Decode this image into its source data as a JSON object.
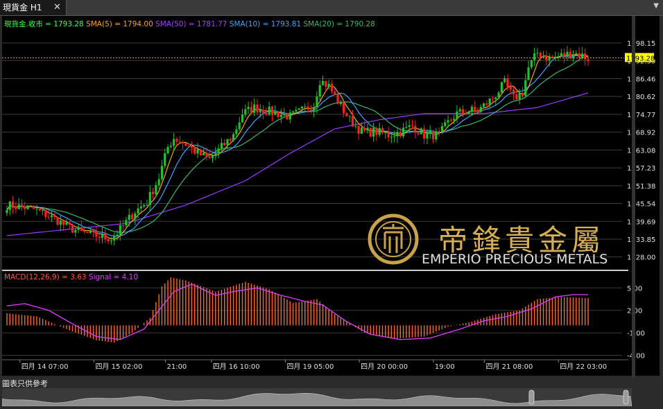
{
  "tab": {
    "title": "現貨金 H1",
    "close": "✕"
  },
  "footer_note": "圖表只供參考",
  "colors": {
    "bull": "#23c12e",
    "bear": "#ff2020",
    "sma5": "#f5a623",
    "sma10": "#3fa3ff",
    "sma20": "#3cb86b",
    "sma50": "#9a3cff",
    "macd_hist": "#ff6a30",
    "signal": "#e040ff",
    "price_line": "#ff9900"
  },
  "brand": {
    "chinese": "帝鋒貴金屬",
    "english": "EMPERIO PRECIOUS METALS"
  },
  "chart_data": [
    {
      "type": "candlestick",
      "title": "現貨金.收市",
      "legend": [
        {
          "label": "現貨金.收市 = 1793.28",
          "color": "#3cff4c"
        },
        {
          "label": "SMA(5) = 1794.00",
          "color": "#f5a623"
        },
        {
          "label": "SMA(50) = 1781.77",
          "color": "#a040ff"
        },
        {
          "label": "SMA(10) = 1793.81",
          "color": "#3fa3ff"
        },
        {
          "label": "SMA(20) = 1790.28",
          "color": "#3cb86b"
        }
      ],
      "ylim": [
        1725.2,
        1801.8
      ],
      "yticks": [
        "1798.15",
        "1792.39",
        "1786.46",
        "1780.62",
        "1774.77",
        "1768.92",
        "1763.08",
        "1757.23",
        "1751.38",
        "1745.54",
        "1739.69",
        "1733.85",
        "1728.00"
      ],
      "last_price": "1793.28",
      "anchors": [
        [
          0,
          1745
        ],
        [
          8,
          1744
        ],
        [
          13,
          1742
        ],
        [
          17,
          1740
        ],
        [
          20,
          1738
        ],
        [
          25,
          1736
        ],
        [
          30,
          1735
        ],
        [
          35,
          1734
        ],
        [
          38,
          1737
        ],
        [
          43,
          1743
        ],
        [
          47,
          1746
        ],
        [
          51,
          1754
        ],
        [
          54,
          1764
        ],
        [
          56,
          1767
        ],
        [
          60,
          1765
        ],
        [
          64,
          1762
        ],
        [
          68,
          1760
        ],
        [
          71,
          1763
        ],
        [
          76,
          1768
        ],
        [
          79,
          1775
        ],
        [
          83,
          1777
        ],
        [
          87,
          1776
        ],
        [
          91,
          1775
        ],
        [
          95,
          1774
        ],
        [
          99,
          1776
        ],
        [
          103,
          1778
        ],
        [
          105,
          1786
        ],
        [
          108,
          1784
        ],
        [
          111,
          1779
        ],
        [
          115,
          1773
        ],
        [
          119,
          1769
        ],
        [
          124,
          1769
        ],
        [
          128,
          1768
        ],
        [
          132,
          1769
        ],
        [
          136,
          1771
        ],
        [
          140,
          1768
        ],
        [
          145,
          1768
        ],
        [
          148,
          1772
        ],
        [
          151,
          1775
        ],
        [
          155,
          1776
        ],
        [
          158,
          1776
        ],
        [
          163,
          1780
        ],
        [
          167,
          1785
        ],
        [
          170,
          1780
        ],
        [
          173,
          1782
        ],
        [
          175,
          1790
        ],
        [
          178,
          1795
        ],
        [
          182,
          1793
        ],
        [
          186,
          1794
        ],
        [
          190,
          1795
        ],
        [
          193,
          1794
        ],
        [
          195,
          1793
        ]
      ],
      "sma50_anchors": [
        [
          0,
          1735
        ],
        [
          20,
          1737
        ],
        [
          40,
          1739
        ],
        [
          60,
          1745
        ],
        [
          80,
          1753
        ],
        [
          95,
          1762
        ],
        [
          110,
          1770
        ],
        [
          125,
          1773
        ],
        [
          140,
          1775
        ],
        [
          160,
          1775
        ],
        [
          178,
          1777
        ],
        [
          195,
          1781.8
        ]
      ],
      "count": 196
    },
    {
      "type": "bar",
      "title": "MACD(12,26,9)",
      "legend": [
        {
          "label": "MACD(12,26,9) = 3.63",
          "color": "#ff5a3c"
        },
        {
          "label": "Signal = 4.10",
          "color": "#e040ff"
        }
      ],
      "ylim": [
        -4.6,
        6.6
      ],
      "yticks": [
        "5.00",
        "2.00",
        "-1.00",
        "-4.00"
      ],
      "macd_anchors": [
        [
          0,
          1.6
        ],
        [
          10,
          1.2
        ],
        [
          20,
          -0.5
        ],
        [
          30,
          -2.0
        ],
        [
          36,
          -2.3
        ],
        [
          42,
          -1.0
        ],
        [
          48,
          1.0
        ],
        [
          52,
          5.2
        ],
        [
          55,
          6.4
        ],
        [
          60,
          6.0
        ],
        [
          70,
          4.5
        ],
        [
          80,
          5.8
        ],
        [
          88,
          4.8
        ],
        [
          96,
          3.0
        ],
        [
          104,
          3.5
        ],
        [
          110,
          1.5
        ],
        [
          120,
          -1.0
        ],
        [
          130,
          -1.8
        ],
        [
          140,
          -1.5
        ],
        [
          148,
          -0.2
        ],
        [
          156,
          0.5
        ],
        [
          164,
          1.5
        ],
        [
          172,
          2.0
        ],
        [
          178,
          3.5
        ],
        [
          186,
          3.8
        ],
        [
          195,
          3.63
        ]
      ],
      "signal_anchors": [
        [
          0,
          2.6
        ],
        [
          6,
          2.9
        ],
        [
          14,
          2.0
        ],
        [
          22,
          0.2
        ],
        [
          30,
          -1.5
        ],
        [
          38,
          -1.9
        ],
        [
          46,
          -0.5
        ],
        [
          52,
          2.5
        ],
        [
          56,
          4.5
        ],
        [
          62,
          5.5
        ],
        [
          70,
          4.0
        ],
        [
          76,
          4.5
        ],
        [
          84,
          5.0
        ],
        [
          92,
          4.0
        ],
        [
          100,
          3.2
        ],
        [
          106,
          2.7
        ],
        [
          114,
          0.5
        ],
        [
          122,
          -1.2
        ],
        [
          132,
          -1.9
        ],
        [
          142,
          -1.7
        ],
        [
          152,
          -0.5
        ],
        [
          160,
          0.6
        ],
        [
          168,
          1.2
        ],
        [
          176,
          2.2
        ],
        [
          184,
          3.8
        ],
        [
          190,
          4.1
        ],
        [
          195,
          4.1
        ]
      ]
    }
  ],
  "x_labels": [
    {
      "i": 4,
      "text": "四月 14 07:00"
    },
    {
      "i": 33,
      "text": "四月 15 02:00"
    },
    {
      "i": 61,
      "text": "21:00"
    },
    {
      "i": 79,
      "text": "四月 16 10:00"
    },
    {
      "i": 108,
      "text": "四月 19 05:00"
    },
    {
      "i": 137,
      "text": "四月 20 00:00"
    },
    {
      "i": 166,
      "text": "19:00"
    },
    {
      "i": 186,
      "text": "四月 21 08:00"
    },
    {
      "i": 215,
      "text": "四月 22 03:00"
    }
  ]
}
